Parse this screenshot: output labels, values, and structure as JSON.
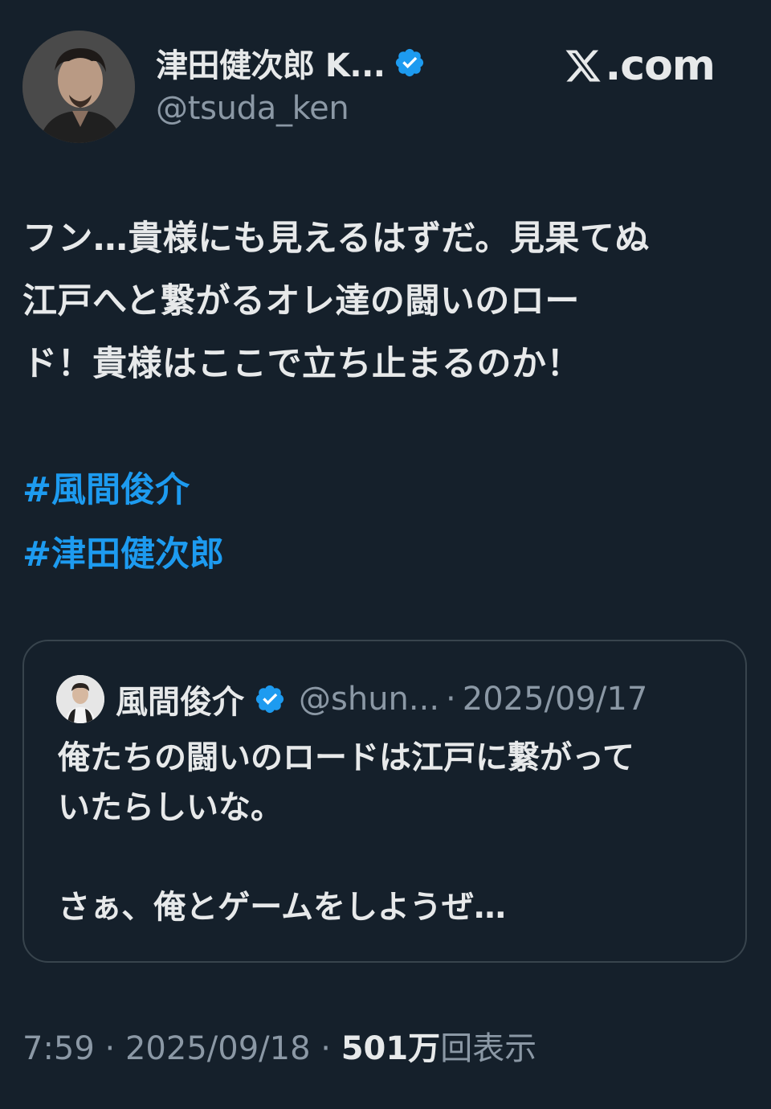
{
  "author": {
    "display_name": "津田健次郎 K...",
    "handle": "@tsuda_ken",
    "verified": true
  },
  "site": {
    "domain": ".com"
  },
  "tweet": {
    "lines": [
      "フン…貴様にも見えるはずだ。見果てぬ",
      "江戸へと繋がるオレ達の闘いのロー",
      "ド！貴様はここで立ち止まるのか！"
    ],
    "hashtags": [
      "#風間俊介",
      "#津田健次郎"
    ]
  },
  "quote": {
    "display_name": "風間俊介",
    "handle": "@shun...",
    "separator": "·",
    "date": "2025/09/17",
    "lines": [
      "俺たちの闘いのロードは江戸に繋がって",
      "いたらしいな。",
      "",
      "さぁ、俺とゲームをしようぜ…"
    ]
  },
  "meta": {
    "time": "7:59",
    "sep1": "·",
    "date": "2025/09/18",
    "sep2": "·",
    "views_count": "501万",
    "views_label": "回表示"
  },
  "colors": {
    "background": "#15202b",
    "text": "#e7e9ea",
    "muted": "#8b98a5",
    "link": "#1d9bf0",
    "border": "#38444d"
  }
}
